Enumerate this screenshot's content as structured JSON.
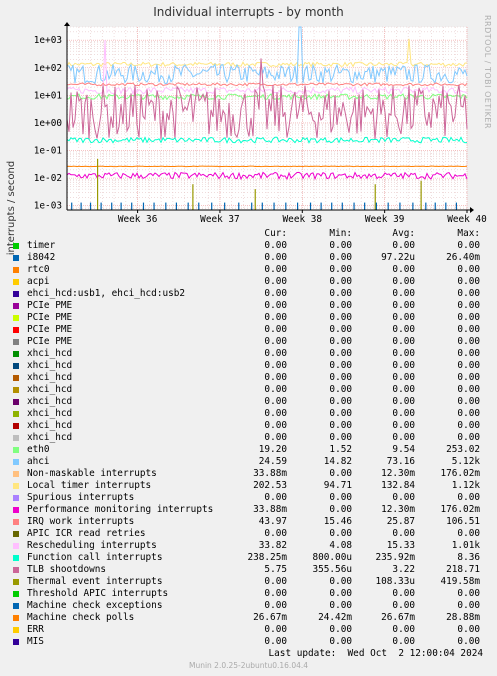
{
  "watermark": "RRDTOOL / TOBI OETIKER",
  "last_update": "Last update:  Wed Oct  2 12:00:04 2024",
  "footer": "Munin 2.0.25-2ubuntu0.16.04.4",
  "legend_headers": {
    "cur": "Cur:",
    "min": "Min:",
    "avg": "Avg:",
    "max": "Max:"
  },
  "legend": [
    {
      "name": "timer",
      "color": "#00cc00",
      "cur": "0.00",
      "min": "0.00",
      "avg": "0.00",
      "max": "0.00"
    },
    {
      "name": "i8042",
      "color": "#0066b3",
      "cur": "0.00",
      "min": "0.00",
      "avg": "97.22u",
      "max": "26.40m"
    },
    {
      "name": "rtc0",
      "color": "#ff8000",
      "cur": "0.00",
      "min": "0.00",
      "avg": "0.00",
      "max": "0.00"
    },
    {
      "name": "acpi",
      "color": "#ffcc00",
      "cur": "0.00",
      "min": "0.00",
      "avg": "0.00",
      "max": "0.00"
    },
    {
      "name": "ehci_hcd:usb1, ehci_hcd:usb2",
      "color": "#330099",
      "cur": "0.00",
      "min": "0.00",
      "avg": "0.00",
      "max": "0.00"
    },
    {
      "name": "PCIe PME",
      "color": "#990099",
      "cur": "0.00",
      "min": "0.00",
      "avg": "0.00",
      "max": "0.00"
    },
    {
      "name": "PCIe PME",
      "color": "#ccff00",
      "cur": "0.00",
      "min": "0.00",
      "avg": "0.00",
      "max": "0.00"
    },
    {
      "name": "PCIe PME",
      "color": "#ff0000",
      "cur": "0.00",
      "min": "0.00",
      "avg": "0.00",
      "max": "0.00"
    },
    {
      "name": "PCIe PME",
      "color": "#808080",
      "cur": "0.00",
      "min": "0.00",
      "avg": "0.00",
      "max": "0.00"
    },
    {
      "name": "xhci_hcd",
      "color": "#008f00",
      "cur": "0.00",
      "min": "0.00",
      "avg": "0.00",
      "max": "0.00"
    },
    {
      "name": "xhci_hcd",
      "color": "#00487d",
      "cur": "0.00",
      "min": "0.00",
      "avg": "0.00",
      "max": "0.00"
    },
    {
      "name": "xhci_hcd",
      "color": "#b35a00",
      "cur": "0.00",
      "min": "0.00",
      "avg": "0.00",
      "max": "0.00"
    },
    {
      "name": "xhci_hcd",
      "color": "#b38f00",
      "cur": "0.00",
      "min": "0.00",
      "avg": "0.00",
      "max": "0.00"
    },
    {
      "name": "xhci_hcd",
      "color": "#6b006b",
      "cur": "0.00",
      "min": "0.00",
      "avg": "0.00",
      "max": "0.00"
    },
    {
      "name": "xhci_hcd",
      "color": "#8fb300",
      "cur": "0.00",
      "min": "0.00",
      "avg": "0.00",
      "max": "0.00"
    },
    {
      "name": "xhci_hcd",
      "color": "#b30000",
      "cur": "0.00",
      "min": "0.00",
      "avg": "0.00",
      "max": "0.00"
    },
    {
      "name": "xhci_hcd",
      "color": "#bebebe",
      "cur": "0.00",
      "min": "0.00",
      "avg": "0.00",
      "max": "0.00"
    },
    {
      "name": "eth0",
      "color": "#80ff80",
      "cur": "19.20",
      "min": "1.52",
      "avg": "9.54",
      "max": "253.02"
    },
    {
      "name": "ahci",
      "color": "#80c9ff",
      "cur": "24.59",
      "min": "14.82",
      "avg": "73.16",
      "max": "5.12k"
    },
    {
      "name": "Non-maskable interrupts",
      "color": "#ffc080",
      "cur": "33.88m",
      "min": "0.00",
      "avg": "12.30m",
      "max": "176.02m"
    },
    {
      "name": "Local timer interrupts",
      "color": "#ffe680",
      "cur": "202.53",
      "min": "94.71",
      "avg": "132.84",
      "max": "1.12k"
    },
    {
      "name": "Spurious interrupts",
      "color": "#aa80ff",
      "cur": "0.00",
      "min": "0.00",
      "avg": "0.00",
      "max": "0.00"
    },
    {
      "name": "Performance monitoring interrupts",
      "color": "#ee00cc",
      "cur": "33.88m",
      "min": "0.00",
      "avg": "12.30m",
      "max": "176.02m"
    },
    {
      "name": "IRQ work interrupts",
      "color": "#ff8080",
      "cur": "43.97",
      "min": "15.46",
      "avg": "25.87",
      "max": "106.51"
    },
    {
      "name": "APIC ICR read retries",
      "color": "#666600",
      "cur": "0.00",
      "min": "0.00",
      "avg": "0.00",
      "max": "0.00"
    },
    {
      "name": "Rescheduling interrupts",
      "color": "#ffbfff",
      "cur": "33.82",
      "min": "4.08",
      "avg": "15.33",
      "max": "1.01k"
    },
    {
      "name": "Function call interrupts",
      "color": "#00ffcc",
      "cur": "238.25m",
      "min": "800.00u",
      "avg": "235.92m",
      "max": "8.36"
    },
    {
      "name": "TLB shootdowns",
      "color": "#cc6699",
      "cur": "5.75",
      "min": "355.56u",
      "avg": "3.22",
      "max": "218.71"
    },
    {
      "name": "Thermal event interrupts",
      "color": "#999900",
      "cur": "0.00",
      "min": "0.00",
      "avg": "108.33u",
      "max": "419.58m"
    },
    {
      "name": "Threshold APIC interrupts",
      "color": "#00cc00",
      "cur": "0.00",
      "min": "0.00",
      "avg": "0.00",
      "max": "0.00"
    },
    {
      "name": "Machine check exceptions",
      "color": "#0066b3",
      "cur": "0.00",
      "min": "0.00",
      "avg": "0.00",
      "max": "0.00"
    },
    {
      "name": "Machine check polls",
      "color": "#ff8000",
      "cur": "26.67m",
      "min": "24.42m",
      "avg": "26.67m",
      "max": "28.88m"
    },
    {
      "name": "ERR",
      "color": "#ffcc00",
      "cur": "0.00",
      "min": "0.00",
      "avg": "0.00",
      "max": "0.00"
    },
    {
      "name": "MIS",
      "color": "#330099",
      "cur": "0.00",
      "min": "0.00",
      "avg": "0.00",
      "max": "0.00"
    }
  ],
  "chart_data": {
    "type": "line",
    "title": "Individual interrupts - by month",
    "ylabel": "interrupts / second",
    "yscale": "log",
    "ylim": [
      0.0007,
      3000
    ],
    "yticks": [
      {
        "value": 0.001,
        "label": "1e-03"
      },
      {
        "value": 0.01,
        "label": "1e-02"
      },
      {
        "value": 0.1,
        "label": "1e-01"
      },
      {
        "value": 1,
        "label": "1e+00"
      },
      {
        "value": 10,
        "label": "1e+01"
      },
      {
        "value": 100,
        "label": "1e+02"
      },
      {
        "value": 1000,
        "label": "1e+03"
      }
    ],
    "xlim": [
      0,
      34
    ],
    "xticks": [
      {
        "value": 6,
        "label": "Week 36"
      },
      {
        "value": 13,
        "label": "Week 37"
      },
      {
        "value": 20,
        "label": "Week 38"
      },
      {
        "value": 27,
        "label": "Week 39"
      },
      {
        "value": 34,
        "label": "Week 40"
      }
    ],
    "grid": true,
    "series": [
      {
        "name": "Local timer interrupts",
        "color": "#ffe680",
        "level": 133,
        "spread": 0.08,
        "spikes": [
          {
            "x": 29,
            "y": 1120
          }
        ]
      },
      {
        "name": "ahci",
        "color": "#80c9ff",
        "level": 60,
        "spread": 0.35,
        "spikes": [
          {
            "x": 19.8,
            "y": 5120
          }
        ]
      },
      {
        "name": "Rescheduling interrupts",
        "color": "#ffbfff",
        "level": 15,
        "spread": 0.12,
        "spikes": [
          {
            "x": 3.2,
            "y": 1010
          }
        ]
      },
      {
        "name": "IRQ work interrupts",
        "color": "#ff8080",
        "level": 25,
        "spread": 0.05,
        "spikes": []
      },
      {
        "name": "eth0",
        "color": "#80ff80",
        "level": 9,
        "spread": 0.1,
        "spikes": []
      },
      {
        "name": "TLB shootdowns",
        "color": "#cc6699",
        "level": 2.5,
        "spread": 1.0,
        "spikes": [
          {
            "x": 16.5,
            "y": 218.71
          }
        ]
      },
      {
        "name": "Function call interrupts",
        "color": "#00ffcc",
        "level": 0.24,
        "spread": 0.1,
        "spikes": []
      },
      {
        "name": "Machine check polls",
        "color": "#ff8000",
        "level": 0.0267,
        "spread": 0.01,
        "spikes": []
      },
      {
        "name": "Performance monitoring interrupts",
        "color": "#ee00cc",
        "level": 0.0123,
        "spread": 0.12,
        "spikes": []
      },
      {
        "name": "Thermal event interrupts",
        "color": "#999900",
        "level": 0,
        "spread": 0,
        "spikes": [
          {
            "x": 2.6,
            "y": 0.05
          },
          {
            "x": 10.7,
            "y": 0.006
          },
          {
            "x": 16,
            "y": 0.004
          },
          {
            "x": 26.2,
            "y": 0.006
          },
          {
            "x": 30.1,
            "y": 0.008
          }
        ]
      },
      {
        "name": "i8042",
        "color": "#0066b3",
        "level": 0,
        "spread": 0,
        "spikes": [
          {
            "x": 0.4,
            "y": 0.0013
          },
          {
            "x": 1.2,
            "y": 0.0013
          },
          {
            "x": 2.0,
            "y": 0.0013
          },
          {
            "x": 2.9,
            "y": 0.0013
          },
          {
            "x": 3.8,
            "y": 0.0013
          },
          {
            "x": 4.6,
            "y": 0.0013
          },
          {
            "x": 5.5,
            "y": 0.0013
          },
          {
            "x": 6.5,
            "y": 0.0013
          },
          {
            "x": 7.4,
            "y": 0.0013
          },
          {
            "x": 8.4,
            "y": 0.0013
          },
          {
            "x": 9.3,
            "y": 0.0013
          },
          {
            "x": 10.3,
            "y": 0.0013
          },
          {
            "x": 11.2,
            "y": 0.0013
          },
          {
            "x": 12.3,
            "y": 0.0013
          },
          {
            "x": 13.4,
            "y": 0.0013
          },
          {
            "x": 14.6,
            "y": 0.0013
          },
          {
            "x": 15.7,
            "y": 0.0013
          },
          {
            "x": 16.6,
            "y": 0.0013
          },
          {
            "x": 17.6,
            "y": 0.0013
          },
          {
            "x": 18.6,
            "y": 0.0013
          },
          {
            "x": 19.6,
            "y": 0.0013
          },
          {
            "x": 20.7,
            "y": 0.0013
          },
          {
            "x": 21.6,
            "y": 0.0013
          },
          {
            "x": 22.5,
            "y": 0.0013
          },
          {
            "x": 23.4,
            "y": 0.0013
          },
          {
            "x": 24.4,
            "y": 0.0013
          },
          {
            "x": 25.3,
            "y": 0.0013
          },
          {
            "x": 26.3,
            "y": 0.0013
          },
          {
            "x": 27.3,
            "y": 0.0013
          },
          {
            "x": 28.3,
            "y": 0.0013
          },
          {
            "x": 29.4,
            "y": 0.0013
          },
          {
            "x": 30.5,
            "y": 0.0013
          },
          {
            "x": 31.3,
            "y": 0.0013
          },
          {
            "x": 32.2,
            "y": 0.0013
          },
          {
            "x": 33.1,
            "y": 0.0013
          }
        ]
      }
    ]
  }
}
